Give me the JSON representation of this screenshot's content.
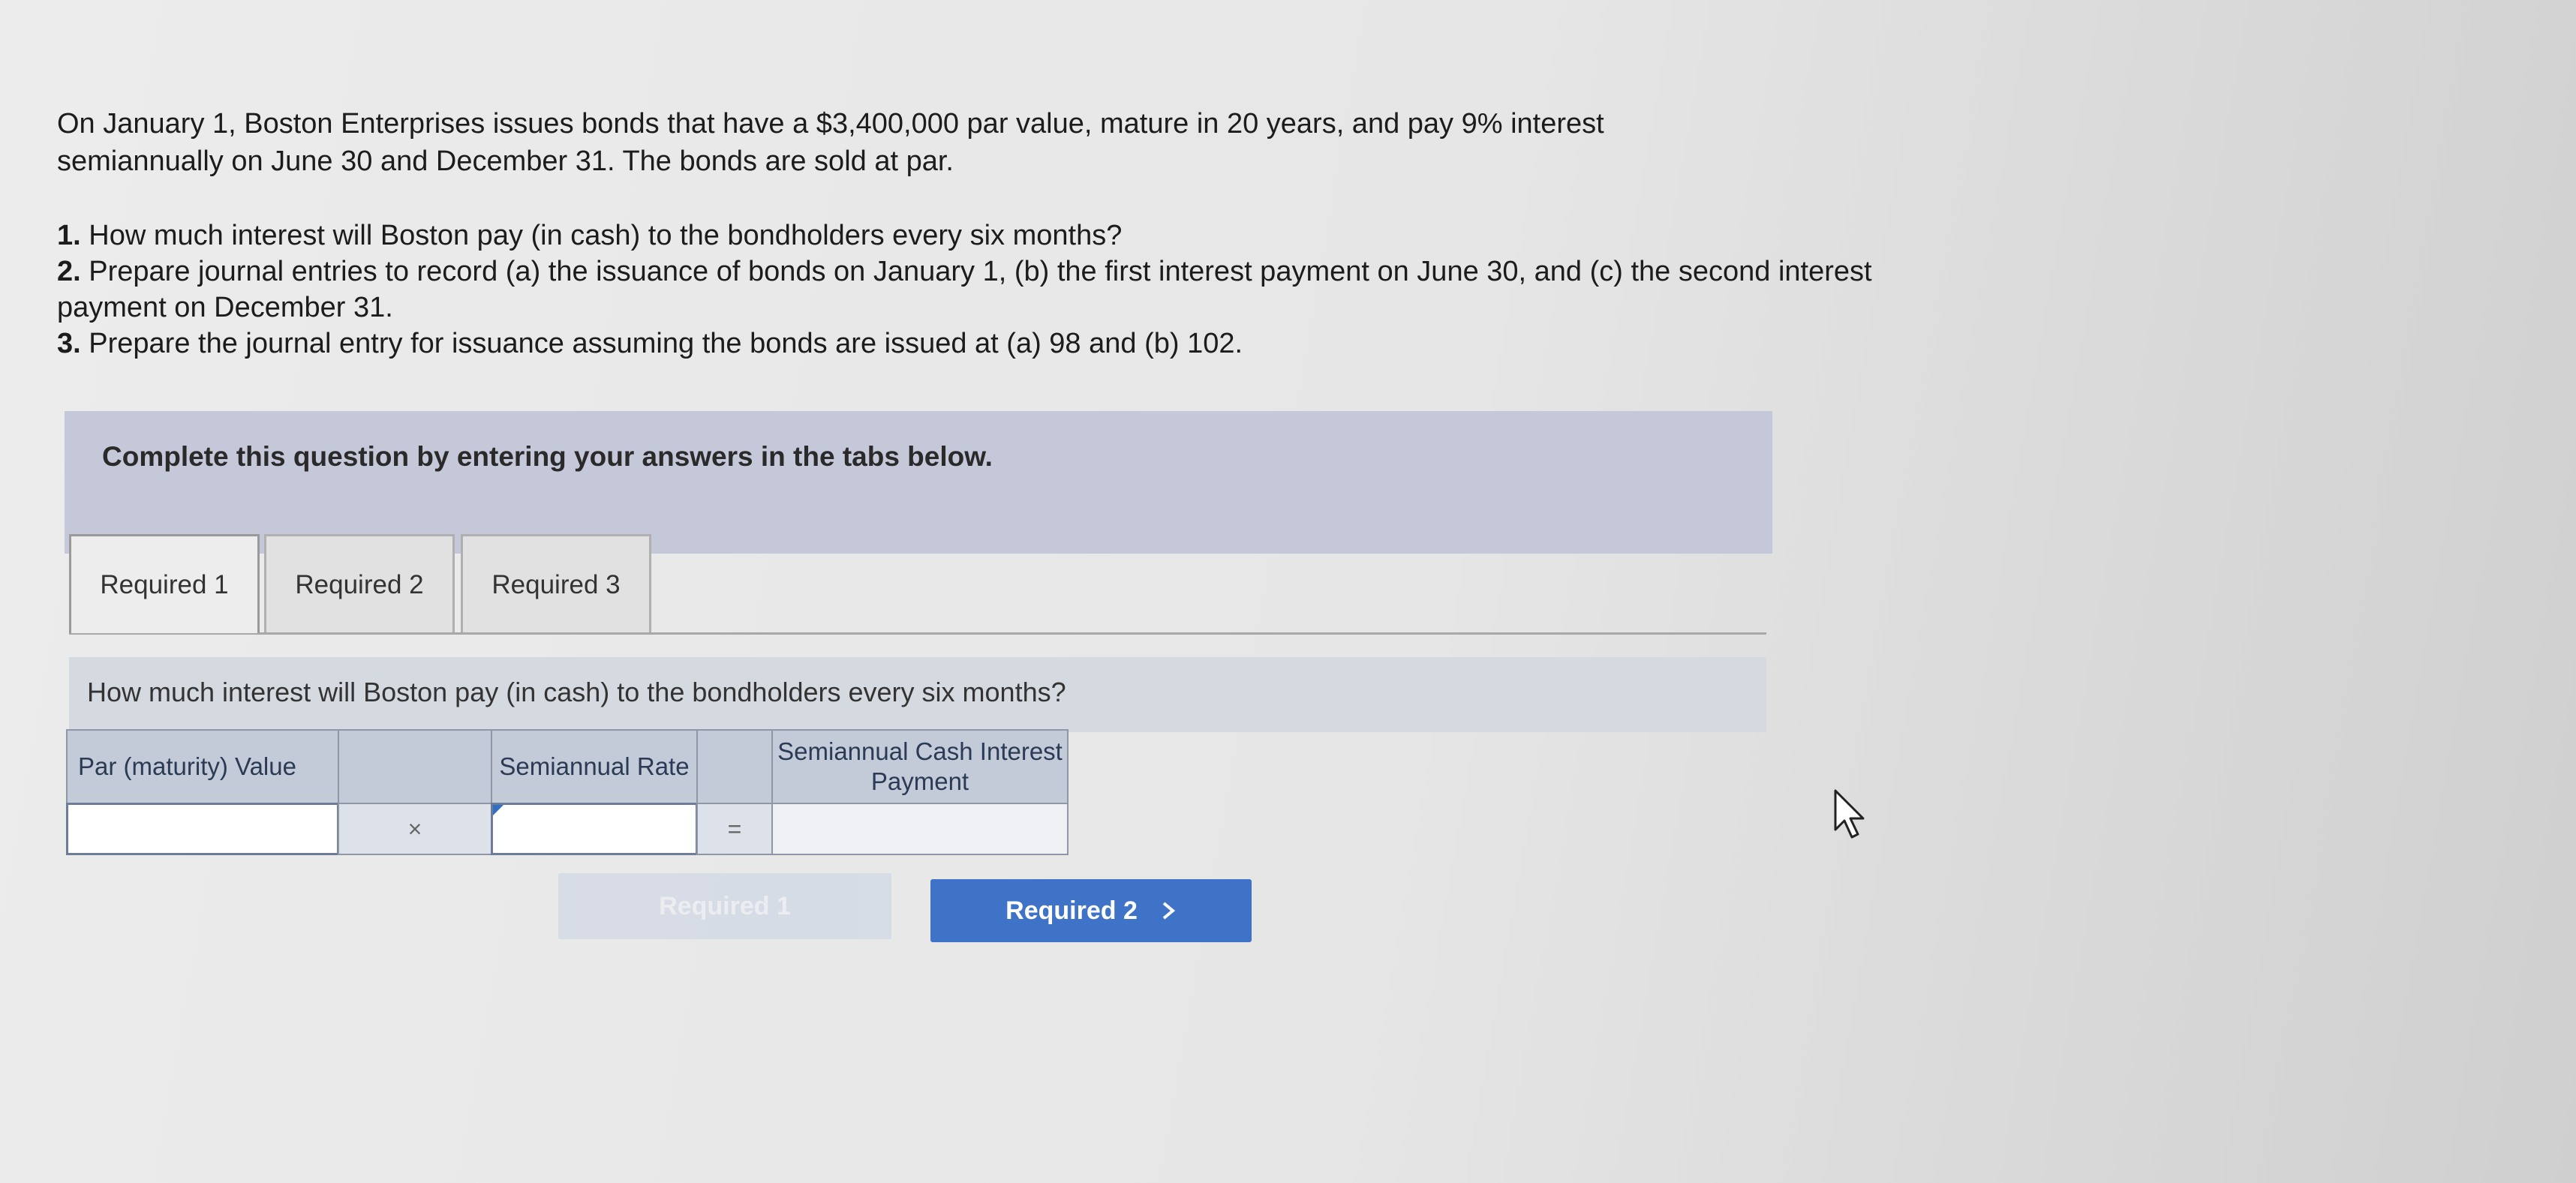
{
  "problem": {
    "line1": "On January 1, Boston Enterprises issues bonds that have a $3,400,000 par value, mature in 20 years, and pay 9% interest",
    "line2": "semiannually on June 30 and December 31. The bonds are sold at par."
  },
  "questions": [
    {
      "num": "1.",
      "text": "How much interest will Boston pay (in cash) to the bondholders every six months?"
    },
    {
      "num": "2.",
      "text": "Prepare journal entries to record (a) the issuance of bonds on January 1, (b) the first interest payment on June 30, and (c) the second interest payment on December 31."
    },
    {
      "num": "3.",
      "text": "Prepare the journal entry for issuance assuming the bonds are issued at (a) 98 and (b) 102."
    }
  ],
  "instruction": "Complete this question by entering your answers in the tabs below.",
  "tabs": [
    {
      "label": "Required 1",
      "active": true
    },
    {
      "label": "Required 2",
      "active": false
    },
    {
      "label": "Required 3",
      "active": false
    }
  ],
  "tab_question": "How much interest will Boston pay (in cash) to the bondholders every six months?",
  "grid": {
    "headers": {
      "par": "Par (maturity) Value",
      "rate": "Semiannual Rate",
      "payment": "Semiannual Cash Interest Payment"
    },
    "operators": {
      "times": "×",
      "equals": "="
    },
    "values": {
      "par": "",
      "rate": "",
      "payment": ""
    }
  },
  "nav": {
    "prev_label": "Required 1",
    "next_label": "Required 2",
    "next_icon": "chevron-right-icon"
  },
  "colors": {
    "accent": "#3e73c8",
    "instruction_bg": "#c5c8d8",
    "header_bg": "#c3cbd9"
  }
}
